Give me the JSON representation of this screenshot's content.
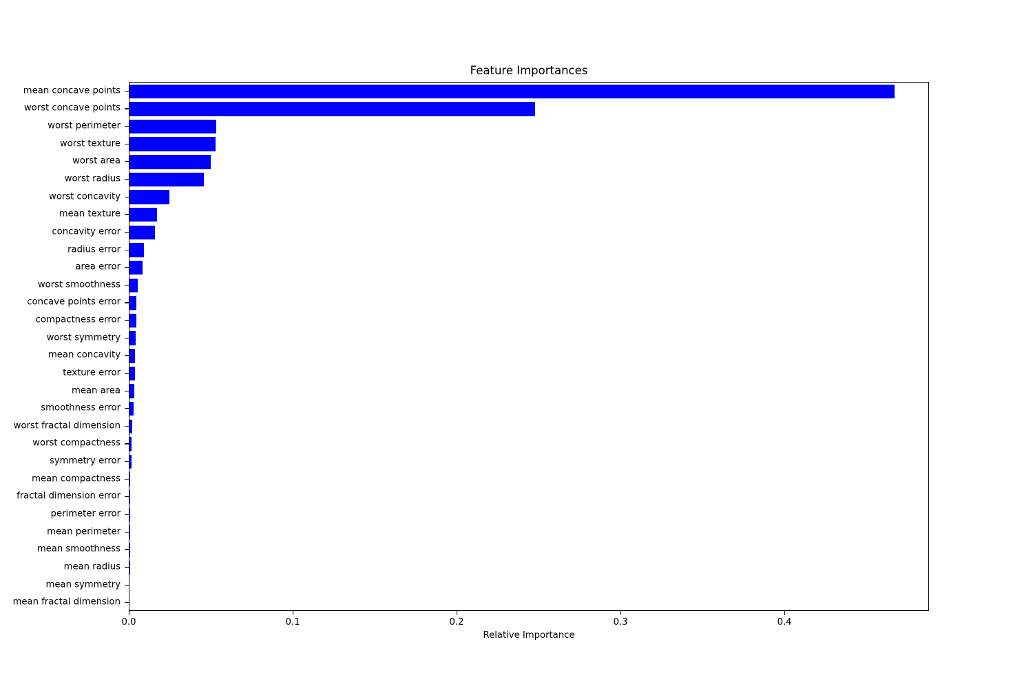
{
  "chart_data": {
    "type": "bar",
    "orientation": "horizontal",
    "title": "Feature Importances",
    "xlabel": "Relative Importance",
    "ylabel": "",
    "xlim": [
      0.0,
      0.4882
    ],
    "xticks": [
      0.0,
      0.1,
      0.2,
      0.3,
      0.4
    ],
    "xtick_labels": [
      "0.0",
      "0.1",
      "0.2",
      "0.3",
      "0.4"
    ],
    "grid": false,
    "legend": null,
    "bar_color": "#0000ff",
    "categories": [
      "mean concave points",
      "worst concave points",
      "worst perimeter",
      "worst texture",
      "worst area",
      "worst radius",
      "worst concavity",
      "mean texture",
      "concavity error",
      "radius error",
      "area error",
      "worst smoothness",
      "concave points error",
      "compactness error",
      "worst symmetry",
      "mean concavity",
      "texture error",
      "mean area",
      "smoothness error",
      "worst fractal dimension",
      "worst compactness",
      "symmetry error",
      "mean compactness",
      "fractal dimension error",
      "perimeter error",
      "mean perimeter",
      "mean smoothness",
      "mean radius",
      "mean symmetry",
      "mean fractal dimension"
    ],
    "values": [
      0.4668,
      0.2475,
      0.0529,
      0.0527,
      0.0496,
      0.0454,
      0.0242,
      0.017,
      0.0154,
      0.009,
      0.008,
      0.005,
      0.0042,
      0.004,
      0.0037,
      0.0034,
      0.0032,
      0.0029,
      0.0026,
      0.0018,
      0.0013,
      0.0011,
      0.0004,
      0.0003,
      0.0002,
      0.0002,
      0.0001,
      0.0001,
      0.0,
      0.0
    ]
  }
}
